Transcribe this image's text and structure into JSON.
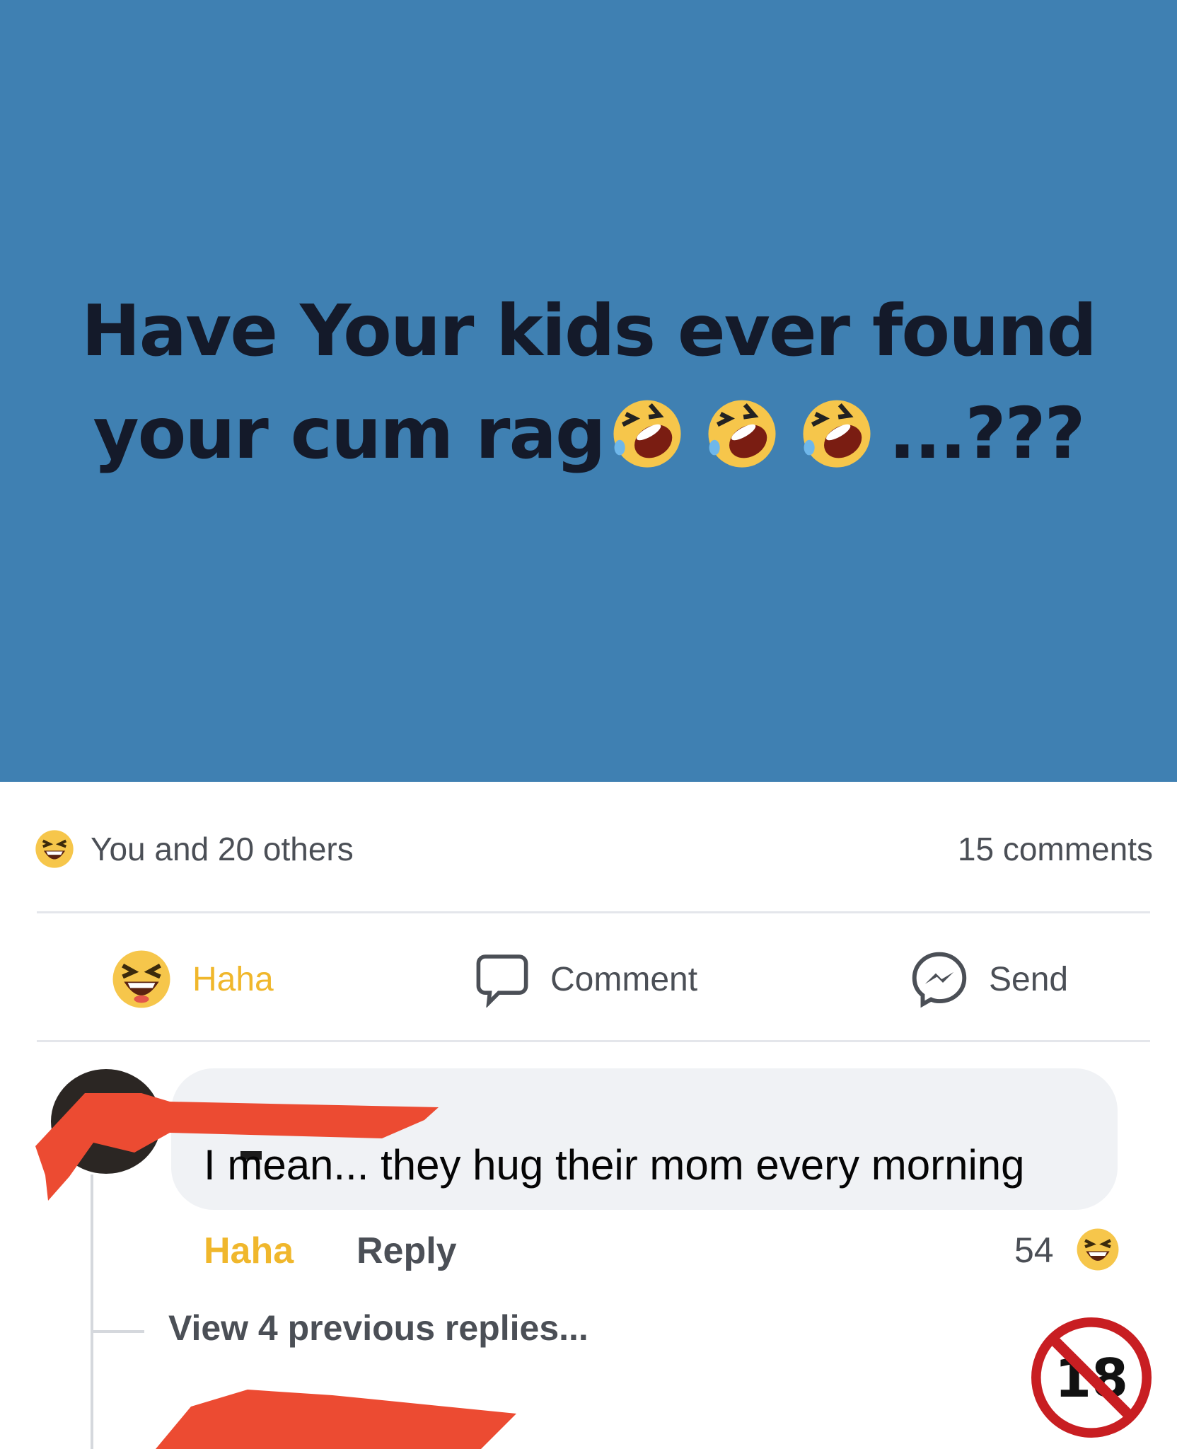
{
  "post": {
    "headline_line1": "Have Your kids ever found",
    "headline_line2_text": "your cum rag",
    "headline_line2_end": "...???",
    "headline_emojis": [
      "rofl-emoji",
      "rofl-emoji",
      "rofl-emoji"
    ],
    "background_color": "#3f80b2"
  },
  "reactions": {
    "summary_icon": "haha-emoji",
    "summary_text": "You and 20 others",
    "comments_count": "15 comments"
  },
  "actions": {
    "haha_label": "Haha",
    "comment_label": "Comment",
    "send_label": "Send",
    "haha_color": "#f0b72c"
  },
  "comment": {
    "text": "I mean... they hug their mom every morning",
    "haha_label": "Haha",
    "reply_label": "Reply",
    "reaction_count": "54",
    "reaction_icon": "haha-emoji",
    "view_replies": "View 4 previous replies..."
  },
  "badge": {
    "label": "18",
    "icon": "no-under-18-icon"
  }
}
